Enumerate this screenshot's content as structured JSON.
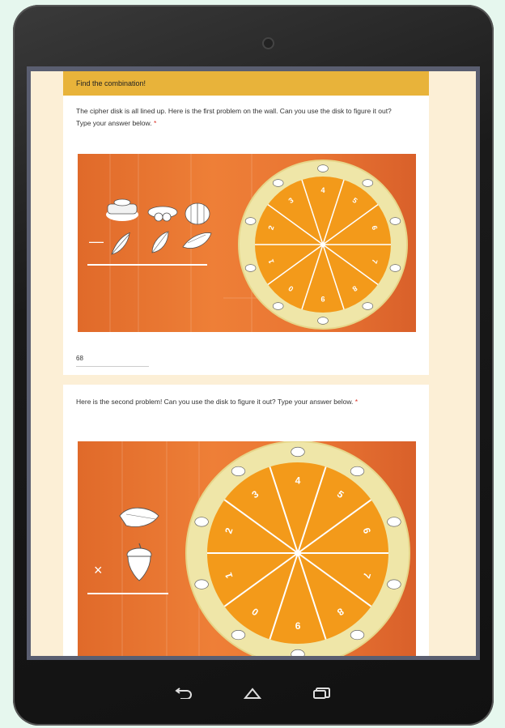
{
  "form": {
    "section_title": "Find the combination!",
    "q1": {
      "prompt": "The cipher disk is all lined up. Here is the first problem on the wall. Can you use the disk to figure it out? Type your answer below.",
      "required_mark": "*",
      "answer": "68",
      "operator": "—",
      "disk_numbers": [
        "4",
        "5",
        "6",
        "7",
        "8",
        "9",
        "0",
        "1",
        "2",
        "3"
      ]
    },
    "q2": {
      "prompt": "Here is the second problem! Can you use the disk to figure it out? Type your answer below.",
      "required_mark": "*",
      "operator": "×",
      "disk_numbers": [
        "4",
        "5",
        "6",
        "7",
        "8",
        "9",
        "0",
        "1",
        "2",
        "3"
      ]
    }
  },
  "nav": {
    "back_icon": "back-arrow-icon",
    "home_icon": "home-icon",
    "recents_icon": "recents-icon"
  },
  "colors": {
    "accent": "#e8b33a",
    "disk_orange": "#f39a1a",
    "disk_ring": "#efe6a8",
    "board": "#e8722f"
  }
}
